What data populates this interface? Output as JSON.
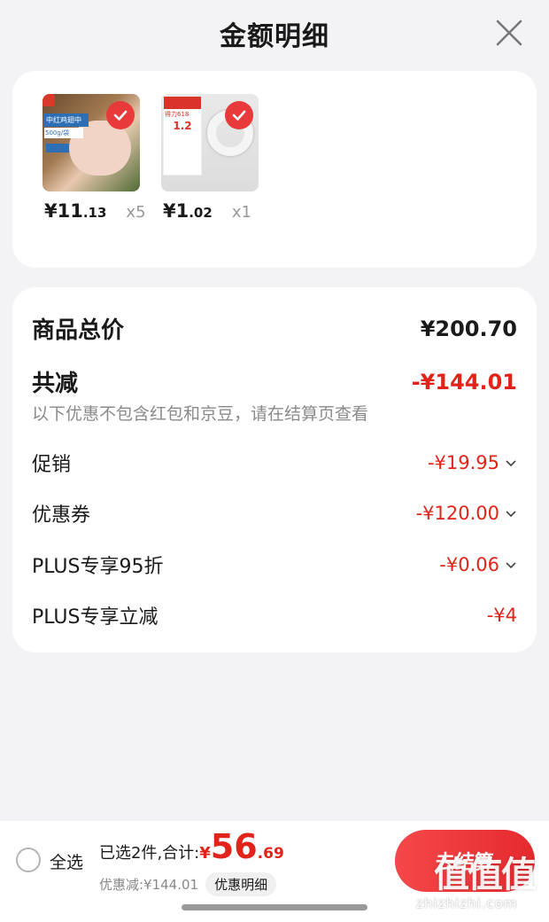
{
  "header": {
    "title": "金额明细"
  },
  "products": [
    {
      "price_int": "¥11",
      "price_dec": ".13",
      "qty": "x5",
      "img_text": "中红鸡翅中",
      "img_sub": "500g/袋"
    },
    {
      "price_int": "¥1",
      "price_dec": ".02",
      "qty": "x1",
      "img_text": "得力618",
      "img_sub": "1.2"
    }
  ],
  "summary": {
    "total_label": "商品总价",
    "total_value": "¥200.70",
    "reduce_label": "共减",
    "reduce_value": "-¥144.01",
    "note": "以下优惠不包含红包和京豆，请在结算页查看"
  },
  "discounts": [
    {
      "label": "促销",
      "value": "-¥19.95",
      "expandable": true
    },
    {
      "label": "优惠券",
      "value": "-¥120.00",
      "expandable": true
    },
    {
      "label": "PLUS专享95折",
      "value": "-¥0.06",
      "expandable": true
    },
    {
      "label": "PLUS专享立减",
      "value": "-¥4",
      "expandable": false
    }
  ],
  "bottom": {
    "select_all": "全选",
    "selected_text": "已选2件,合计:",
    "currency": "¥",
    "total_int": "56",
    "total_dec": ".69",
    "discount_text": "优惠减:¥144.01",
    "detail_button": "优惠明细",
    "checkout_label": "去结算"
  },
  "watermark": {
    "logo": "值值值",
    "url": "zhizhizhi.com"
  },
  "colors": {
    "accent": "#e2231a",
    "background": "#f3f3f5",
    "card": "#ffffff"
  }
}
